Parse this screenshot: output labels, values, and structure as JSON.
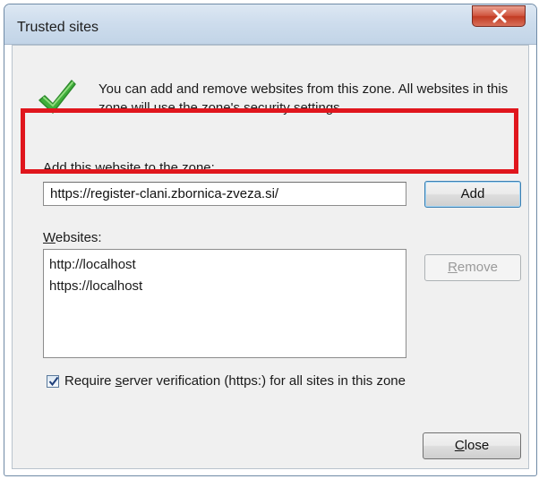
{
  "window": {
    "title": "Trusted sites",
    "close_icon": "close-x-icon"
  },
  "info": {
    "icon": "green-checkmark-icon",
    "text": "You can add and remove websites from this zone. All websites in this zone will use the zone's security settings."
  },
  "add_section": {
    "label_prefix": "A",
    "label_mnemonic": "d",
    "label_rest": "d this website to the zone:",
    "input_value": "https://register-clani.zbornica-zveza.si/",
    "add_button": "Add"
  },
  "websites": {
    "label_mnemonic": "W",
    "label_rest": "ebsites:",
    "items": [
      "http://localhost",
      "https://localhost"
    ],
    "remove_mnemonic": "R",
    "remove_rest": "emove"
  },
  "verification": {
    "checked": true,
    "label_prefix": "Require ",
    "label_mnemonic": "s",
    "label_rest": "erver verification (https:) for all sites in this zone"
  },
  "footer": {
    "close_mnemonic": "C",
    "close_rest": "lose"
  },
  "colors": {
    "highlight_border": "#e0161d",
    "check_green": "#3fae3b"
  }
}
